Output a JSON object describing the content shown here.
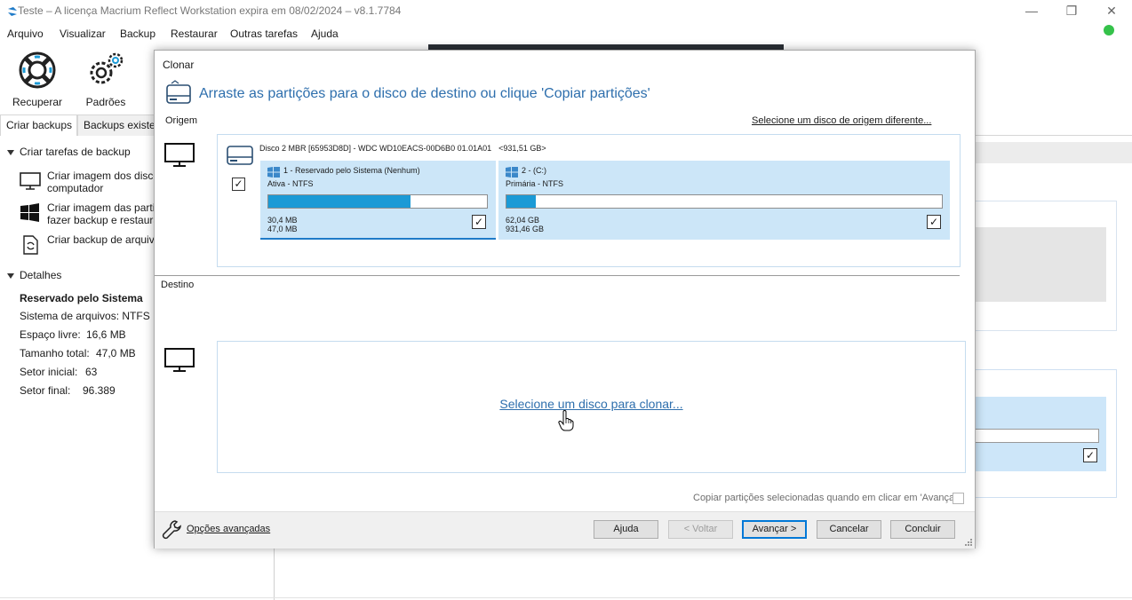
{
  "window": {
    "title": "Teste – A licença Macrium Reflect Workstation expira em 08/02/2024 – v8.1.7784",
    "minimize_glyph": "—",
    "maximize_glyph": "❐",
    "close_glyph": "✕"
  },
  "menu": [
    "Arquivo",
    "Visualizar",
    "Backup",
    "Restaurar",
    "Outras tarefas",
    "Ajuda"
  ],
  "ribbon": {
    "recover_label": "Recuperar",
    "defaults_label": "Padrões"
  },
  "tabs": {
    "create_backups": "Criar backups",
    "existing_backups": "Backups existe"
  },
  "left_panel": {
    "tasks_heading": "Criar tarefas de backup",
    "tasks": [
      {
        "label": "Criar imagem dos disco computador",
        "icon": "monitor-icon"
      },
      {
        "label": "Criar imagem das parti fazer backup e restaura",
        "icon": "windows-icon"
      },
      {
        "label": "Criar backup de arquiv",
        "icon": "file-sync-icon"
      }
    ],
    "details_heading": "Detalhes",
    "details": {
      "partition_name": "Reservado pelo Sistema",
      "filesystem": "Sistema de arquivos: NTFS",
      "free_label": "Espaço livre:",
      "free_value": "16,6 MB",
      "total_label": "Tamanho total:",
      "total_value": "47,0 MB",
      "start_label": "Setor inicial:",
      "start_value": "63",
      "end_label": "Setor final:",
      "end_value": "96.389"
    }
  },
  "dialog": {
    "title": "Clonar",
    "heading": "Arraste as partições para o disco de destino ou clique 'Copiar partições'",
    "origin_label": "Origem",
    "select_source_link": "Selecione um disco de origem diferente...",
    "disk": {
      "name": "Disco 2 MBR [65953D8D] - WDC WD10EACS-00D6B0 01.01A01",
      "size": "<931,51 GB>",
      "checked": true
    },
    "partitions": [
      {
        "name": "1 - Reservado pelo Sistema (Nenhum)",
        "type": "Ativa - NTFS",
        "used": "30,4 MB",
        "total": "47,0 MB",
        "fill_fraction": 0.65,
        "checked": true
      },
      {
        "name": "2 -  (C:)",
        "type": "Primária - NTFS",
        "used": "62,04 GB",
        "total": "931,46 GB",
        "fill_fraction": 0.067,
        "checked": true
      }
    ],
    "destination_label": "Destino",
    "select_target_link": "Selecione um disco para clonar...",
    "copy_option_label": "Copiar partições selecionadas quando em clicar em 'Avançar'",
    "copy_option_checked": false,
    "advanced_options_link": "Opções avançadas",
    "buttons": {
      "help": "Ajuda",
      "back": "< Voltar",
      "next": "Avançar >",
      "cancel": "Cancelar",
      "finish": "Concluir"
    }
  },
  "colors": {
    "heading_blue": "#2e6fad",
    "partition_bg": "#cce6f8",
    "usage_fill": "#1b9ad6",
    "status_green": "#35c24a"
  }
}
